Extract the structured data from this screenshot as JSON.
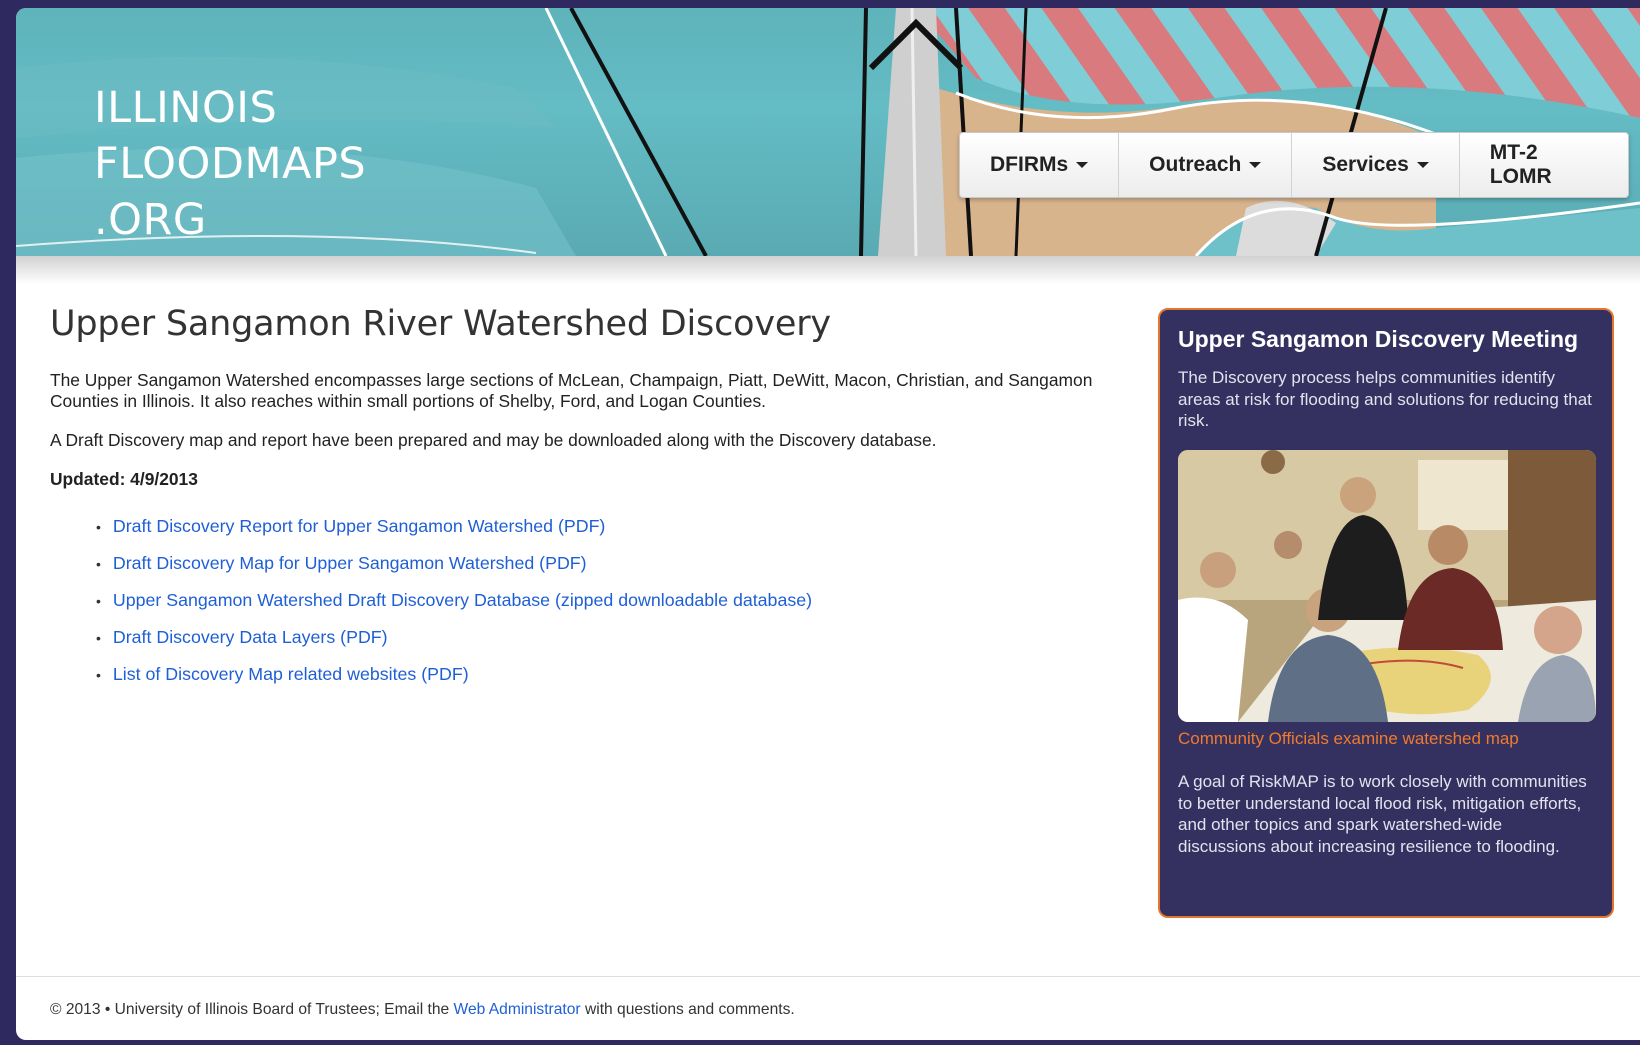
{
  "logo": {
    "line1": "ILLINOIS",
    "line2": "FLOODMAPS",
    "line3": ".ORG"
  },
  "nav": {
    "items": [
      {
        "label": "DFIRMs",
        "has_dropdown": true
      },
      {
        "label": "Outreach",
        "has_dropdown": true
      },
      {
        "label": "Services",
        "has_dropdown": true
      },
      {
        "label": "MT-2 LOMR",
        "has_dropdown": false
      }
    ]
  },
  "main": {
    "title": "Upper Sangamon River Watershed Discovery",
    "intro": "The Upper Sangamon Watershed encompasses large sections of McLean, Champaign, Piatt, DeWitt, Macon, Christian, and Sangamon Counties in Illinois. It also reaches within small portions of Shelby, Ford, and Logan Counties.",
    "draft_note": "A Draft Discovery map and report have been prepared and may be downloaded along with the Discovery database.",
    "updated": "Updated: 4/9/2013",
    "links": [
      "Draft Discovery Report for Upper Sangamon Watershed (PDF)",
      "Draft Discovery Map for Upper Sangamon Watershed (PDF)",
      "Upper Sangamon Watershed Draft Discovery Database (zipped downloadable database)",
      "Draft Discovery Data Layers (PDF)",
      "List of Discovery Map related websites (PDF)"
    ]
  },
  "sidebar": {
    "heading": "Upper Sangamon Discovery Meeting",
    "description": "The Discovery process helps communities identify areas at risk for flooding and solutions for reducing that risk.",
    "photo_caption": "Community Officials examine watershed map",
    "goal": "A goal of RiskMAP is to work closely with communities to better understand local flood risk, mitigation efforts, and other topics and spark watershed-wide discussions about increasing resilience to flooding."
  },
  "footer": {
    "prefix": "© 2013 • University of Illinois Board of Trustees; Email the ",
    "link": "Web Administrator",
    "suffix": " with questions and comments."
  },
  "colors": {
    "frame": "#2e2a60",
    "banner_teal": "#5fb3bb",
    "link_blue": "#1f5fd6",
    "sidebar_bg": "#34305f",
    "sidebar_border": "#e3762f",
    "caption_orange": "#f07a2d"
  }
}
